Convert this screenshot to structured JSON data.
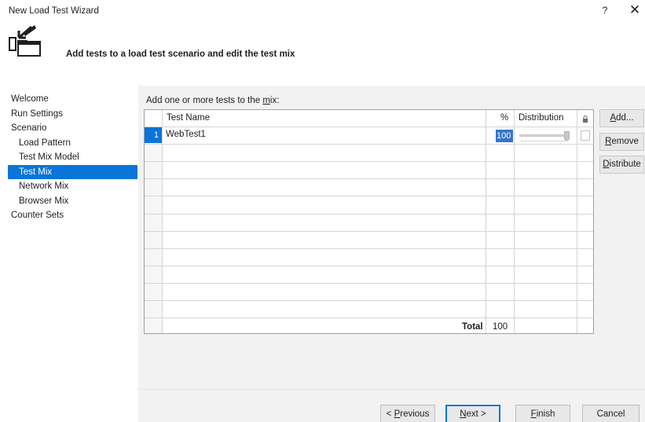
{
  "window": {
    "title": "New Load Test Wizard",
    "help_label": "?",
    "close_label": "✕"
  },
  "header": {
    "icon": "wizard-load-test-icon",
    "text": "Add tests to a load test scenario and edit the test mix"
  },
  "sidebar": {
    "items": [
      {
        "label": "Welcome",
        "sub": false,
        "selected": false
      },
      {
        "label": "Run Settings",
        "sub": false,
        "selected": false
      },
      {
        "label": "Scenario",
        "sub": false,
        "selected": false
      },
      {
        "label": "Load Pattern",
        "sub": true,
        "selected": false
      },
      {
        "label": "Test Mix Model",
        "sub": true,
        "selected": false
      },
      {
        "label": "Test Mix",
        "sub": true,
        "selected": true
      },
      {
        "label": "Network Mix",
        "sub": true,
        "selected": false
      },
      {
        "label": "Browser Mix",
        "sub": true,
        "selected": false
      },
      {
        "label": "Counter Sets",
        "sub": false,
        "selected": false
      }
    ]
  },
  "mix": {
    "label_prefix": "Add one or more tests to the ",
    "label_access": "m",
    "label_suffix": "ix:",
    "columns": {
      "name": "Test Name",
      "percent": "%",
      "distribution": "Distribution",
      "lock_icon": "lock-icon"
    },
    "rows": [
      {
        "number": "1",
        "name": "WebTest1",
        "percent": "100",
        "distribution": 1.0
      }
    ],
    "total_label": "Total",
    "total_value": "100"
  },
  "side_buttons": {
    "add": {
      "access": "A",
      "rest": "dd..."
    },
    "remove": {
      "access": "R",
      "rest": "emove"
    },
    "distribute": {
      "access": "D",
      "rest": "istribute"
    }
  },
  "footer": {
    "previous": {
      "prefix": "< ",
      "access": "P",
      "rest": "revious"
    },
    "next": {
      "access": "N",
      "rest": "ext >"
    },
    "finish": {
      "access": "F",
      "rest": "inish"
    },
    "cancel": {
      "label": "Cancel"
    }
  },
  "colors": {
    "accent": "#0a74d8",
    "selection": "#3874c8",
    "content_bg": "#f2f2f2"
  }
}
